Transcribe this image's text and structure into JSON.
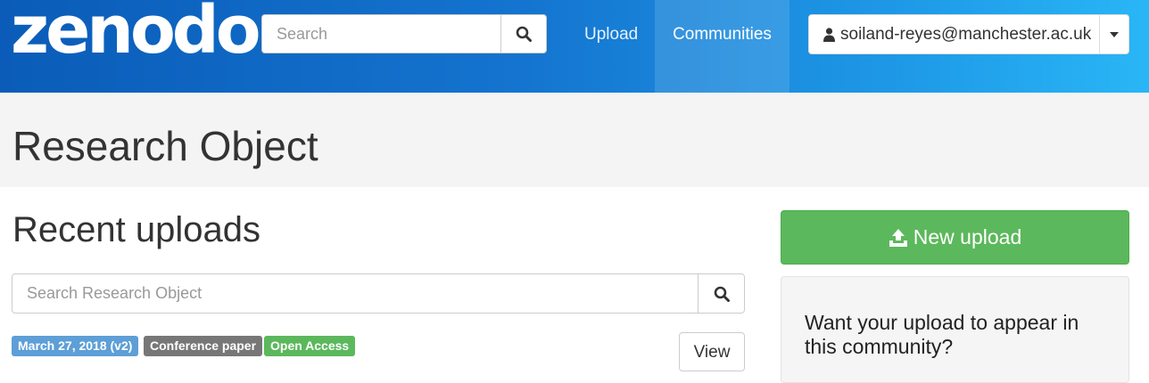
{
  "navbar": {
    "logo": "zenodo",
    "search_placeholder": "Search",
    "links": {
      "upload": "Upload",
      "communities": "Communities"
    },
    "user_email": "soiland-reyes@manchester.ac.uk"
  },
  "header": {
    "title": "Research Object"
  },
  "main": {
    "section_title": "Recent uploads",
    "search_placeholder": "Search Research Object",
    "record": {
      "date_badge": "March 27, 2018 (v2)",
      "type_badge": "Conference paper",
      "access_badge": "Open Access",
      "view_label": "View"
    }
  },
  "sidebar": {
    "new_upload_label": "New upload",
    "panel_text": "Want your upload to appear in this community?"
  },
  "colors": {
    "navbar_start": "#0a5cb8",
    "navbar_end": "#29b6f6",
    "success": "#5cb85c",
    "date_badge": "#5d9fd6",
    "type_badge": "#777777"
  },
  "icons": [
    "search-icon",
    "user-icon",
    "caret-down-icon",
    "upload-icon"
  ]
}
